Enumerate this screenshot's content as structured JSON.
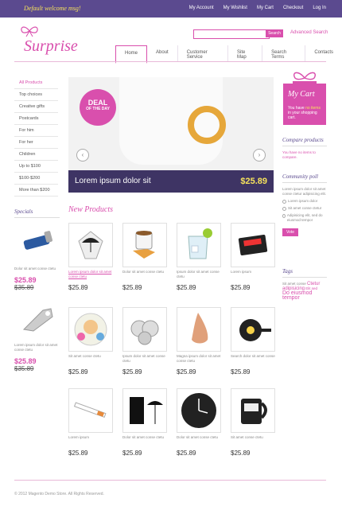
{
  "header": {
    "welcome": "Default welcome msg!",
    "links": [
      "My Account",
      "My Wishlist",
      "My Cart",
      "Checkout",
      "Log In"
    ],
    "logo": "Surprise",
    "search_button": "Search",
    "advanced_search": "Advanced Search"
  },
  "nav": [
    "Home",
    "About",
    "Customer Service",
    "Site Map",
    "Search Terms",
    "Contacts"
  ],
  "categories": [
    "All Products",
    "Top choices",
    "Creative gifts",
    "Postcards",
    "For him",
    "For her",
    "Children",
    "Up to $100",
    "$100-$200",
    "More than $200"
  ],
  "slider": {
    "deal_line1": "DEAL",
    "deal_line2": "OF THE DAY",
    "caption": "Lorem ipsum dolor sit",
    "price": "$25.89",
    "prev": "‹",
    "next": "›"
  },
  "cart": {
    "title": "My Cart",
    "text_before": "You have ",
    "link": "no items",
    "text_after": " in your shopping cart."
  },
  "compare": {
    "title": "Compare products",
    "text": "You have no items to compare."
  },
  "poll": {
    "title": "Community poll",
    "question": "Lorem ipsum dolor sit amet conse ctetur adipisicing elit.",
    "options": [
      "Lorem ipsum dolor",
      "Sit amet conse ctetur",
      "Adipisicing elit, sed do eiusmod tempor"
    ],
    "vote": "Vote"
  },
  "tags_block": {
    "title": "Tags",
    "line1": "Sit amet conse",
    "line1_big": "Ctetur",
    "line2": "adipisicing",
    "line2_pink": "Elit sed",
    "line3": "Do eiusmod",
    "line4": "tempor"
  },
  "specials": {
    "title": "Specials",
    "items": [
      {
        "name": "Dolor sit amet conse ctetu",
        "price": "$25.89",
        "old_price": "$35.89"
      },
      {
        "name": "Lorem ipsum dolor sit amet conse ctetu",
        "price": "$25.89",
        "old_price": "$35.89"
      }
    ]
  },
  "new_products": {
    "title": "New Products",
    "items": [
      {
        "name": "Lorem ipsum dolor sit amet conse ctetu",
        "price": "$25.89"
      },
      {
        "name": "Dolor sit amet conse ctetu",
        "price": "$25.89"
      },
      {
        "name": "Ipsum dolor sit amet conse ctetu",
        "price": "$25.89"
      },
      {
        "name": "Lorem ipsum",
        "price": "$25.89"
      },
      {
        "name": "Sit amet conse ctetu",
        "price": "$25.89"
      },
      {
        "name": "Ipsum dolor sit amet conse ctetu",
        "price": "$25.89"
      },
      {
        "name": "Magna ipsum dolor sit amet conse ctetu",
        "price": "$25.89"
      },
      {
        "name": "Search dolor sit amet conse",
        "price": "$25.89"
      },
      {
        "name": "Lorem ipsum",
        "price": "$25.89"
      },
      {
        "name": "Dolor sit amet conse ctetu",
        "price": "$25.89"
      },
      {
        "name": "Dolor sit amet conse ctetu",
        "price": "$25.89"
      },
      {
        "name": "Sit amet conse ctetu",
        "price": "$25.89"
      }
    ]
  },
  "footer": "© 2012 Magento Demo Store. All Rights Reserved.",
  "colors": {
    "purple": "#5b4a8f",
    "pink": "#d94fad",
    "yellow": "#f6e25c"
  }
}
